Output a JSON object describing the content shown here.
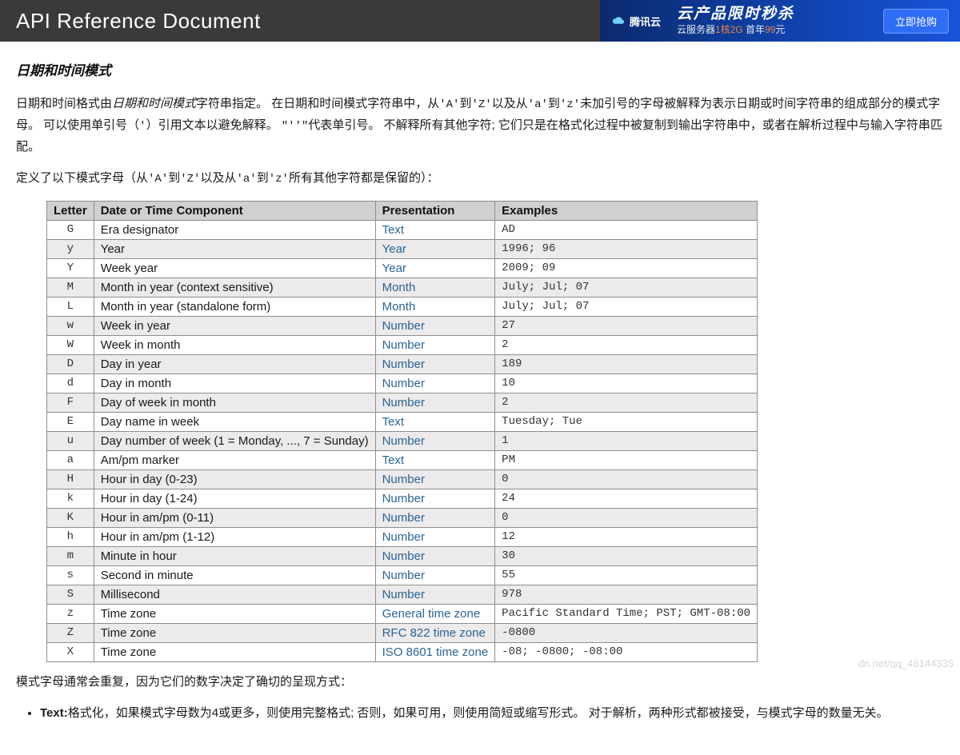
{
  "header": {
    "title": "API Reference Document"
  },
  "ad": {
    "brand": "腾讯云",
    "slogan_big": "云产品限时秒杀",
    "slogan_small_pre": "云服务器",
    "slogan_small_spec": "1核2G",
    "slogan_small_mid": " 首年",
    "slogan_small_price": "99",
    "slogan_small_unit": "元",
    "button": "立即抢购"
  },
  "section_title": "日期和时间模式",
  "para1_a": "日期和时间格式由",
  "para1_em": "日期和时间模式",
  "para1_b": "字符串指定。 在日期和时间模式字符串中，从",
  "lit_A": "'A'",
  "para1_c": "到",
  "lit_Z": "'Z'",
  "para1_d": "以及从",
  "lit_a": "'a'",
  "para1_e": "到",
  "lit_z": "'z'",
  "para1_f": "未加引号的字母被解释为表示日期或时间字符串的组成部分的模式字母。 可以使用单引号（",
  "lit_q": "'",
  "para1_g": "）引用文本以避免解释。",
  "lit_qq": "\"''\"",
  "para1_h": "代表单引号。 不解释所有其他字符; 它们只是在格式化过程中被复制到输出字符串中，或者在解析过程中与输入字符串匹配。",
  "para2_a": "定义了以下模式字母（从",
  "para2_b": "到",
  "para2_c": "以及从",
  "para2_d": "到",
  "para2_e": "所有其他字符都是保留的）：",
  "table_headers": {
    "letter": "Letter",
    "component": "Date or Time Component",
    "presentation": "Presentation",
    "examples": "Examples"
  },
  "rows": [
    {
      "l": "G",
      "c": "Era designator",
      "p": "Text",
      "e": "AD"
    },
    {
      "l": "y",
      "c": "Year",
      "p": "Year",
      "e": "1996; 96"
    },
    {
      "l": "Y",
      "c": "Week year",
      "p": "Year",
      "e": "2009; 09"
    },
    {
      "l": "M",
      "c": "Month in year (context sensitive)",
      "p": "Month",
      "e": "July; Jul; 07"
    },
    {
      "l": "L",
      "c": "Month in year (standalone form)",
      "p": "Month",
      "e": "July; Jul; 07"
    },
    {
      "l": "w",
      "c": "Week in year",
      "p": "Number",
      "e": "27"
    },
    {
      "l": "W",
      "c": "Week in month",
      "p": "Number",
      "e": "2"
    },
    {
      "l": "D",
      "c": "Day in year",
      "p": "Number",
      "e": "189"
    },
    {
      "l": "d",
      "c": "Day in month",
      "p": "Number",
      "e": "10"
    },
    {
      "l": "F",
      "c": "Day of week in month",
      "p": "Number",
      "e": "2"
    },
    {
      "l": "E",
      "c": "Day name in week",
      "p": "Text",
      "e": "Tuesday; Tue"
    },
    {
      "l": "u",
      "c": "Day number of week (1 = Monday, ..., 7 = Sunday)",
      "p": "Number",
      "e": "1"
    },
    {
      "l": "a",
      "c": "Am/pm marker",
      "p": "Text",
      "e": "PM"
    },
    {
      "l": "H",
      "c": "Hour in day (0-23)",
      "p": "Number",
      "e": "0"
    },
    {
      "l": "k",
      "c": "Hour in day (1-24)",
      "p": "Number",
      "e": "24"
    },
    {
      "l": "K",
      "c": "Hour in am/pm (0-11)",
      "p": "Number",
      "e": "0"
    },
    {
      "l": "h",
      "c": "Hour in am/pm (1-12)",
      "p": "Number",
      "e": "12"
    },
    {
      "l": "m",
      "c": "Minute in hour",
      "p": "Number",
      "e": "30"
    },
    {
      "l": "s",
      "c": "Second in minute",
      "p": "Number",
      "e": "55"
    },
    {
      "l": "S",
      "c": "Millisecond",
      "p": "Number",
      "e": "978"
    },
    {
      "l": "z",
      "c": "Time zone",
      "p": "General time zone",
      "e": "Pacific Standard Time; PST; GMT-08:00"
    },
    {
      "l": "Z",
      "c": "Time zone",
      "p": "RFC 822 time zone",
      "e": "-0800"
    },
    {
      "l": "X",
      "c": "Time zone",
      "p": "ISO 8601 time zone",
      "e": "-08; -0800; -08:00"
    }
  ],
  "after_table": "模式字母通常会重复，因为它们的数字决定了确切的呈现方式：",
  "bullet1_label": "Text:",
  "bullet1_text": "格式化，如果模式字母数为4或更多，则使用完整格式; 否则，如果可用，则使用简短或缩写形式。 对于解析，两种形式都被接受，与模式字母的数量无关。",
  "watermark": "dn.net/qq_46144335"
}
